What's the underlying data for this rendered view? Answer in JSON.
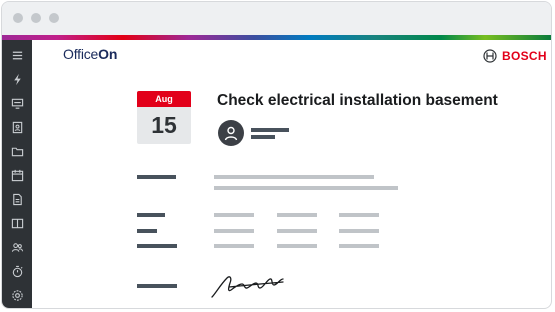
{
  "app": {
    "brand_light": "Office",
    "brand_bold": "On",
    "company": "BOSCH"
  },
  "sidebar": {
    "items": [
      {
        "icon": "menu-icon"
      },
      {
        "icon": "lightning-icon"
      },
      {
        "icon": "monitor-icon"
      },
      {
        "icon": "contact-card-icon"
      },
      {
        "icon": "folder-icon"
      },
      {
        "icon": "calendar-icon"
      },
      {
        "icon": "document-icon"
      },
      {
        "icon": "book-icon"
      },
      {
        "icon": "people-icon"
      },
      {
        "icon": "timer-icon"
      },
      {
        "icon": "settings-icon"
      }
    ]
  },
  "task": {
    "month": "Aug",
    "day": "15",
    "title": "Check electrical installation basement"
  },
  "colors": {
    "accent_red": "#e2001a",
    "sidebar_bg": "#2e3236",
    "brand_blue": "#1a2b5c"
  }
}
